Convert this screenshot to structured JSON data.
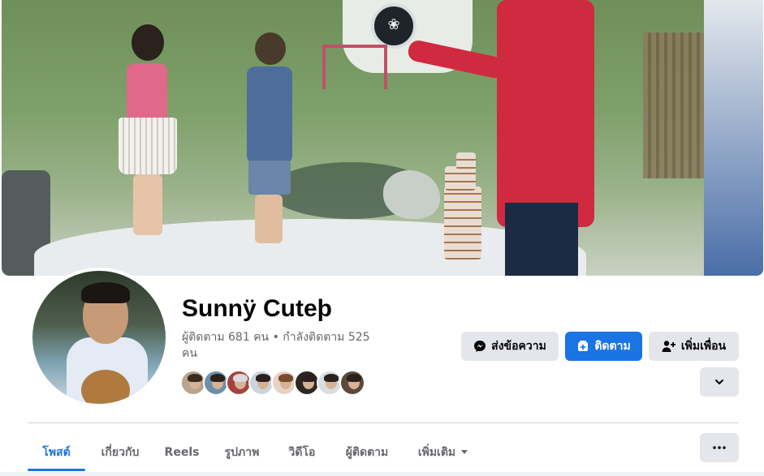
{
  "profile": {
    "name": "Sunnÿ Cuteþ",
    "followers_text": "ผู้ติดตาม 681 คน • กำลังติดตาม 525 คน",
    "friend_avatars_count": 8
  },
  "actions": {
    "message_label": "ส่งข้อความ",
    "follow_label": "ติดตาม",
    "add_friend_label": "เพิ่มเพื่อน",
    "more_icon": "chevron-down-icon"
  },
  "tabs": [
    {
      "label": "โพสต์",
      "active": true
    },
    {
      "label": "เกี่ยวกับ",
      "active": false
    },
    {
      "label": "Reels",
      "active": false
    },
    {
      "label": "รูปภาพ",
      "active": false
    },
    {
      "label": "วิดีโอ",
      "active": false
    },
    {
      "label": "ผู้ติดตาม",
      "active": false
    },
    {
      "label": "เพิ่มเติม",
      "active": false
    }
  ],
  "colors": {
    "accent": "#1b74e4",
    "button_gray": "#e4e6eb",
    "secondary_text": "#65676b"
  }
}
